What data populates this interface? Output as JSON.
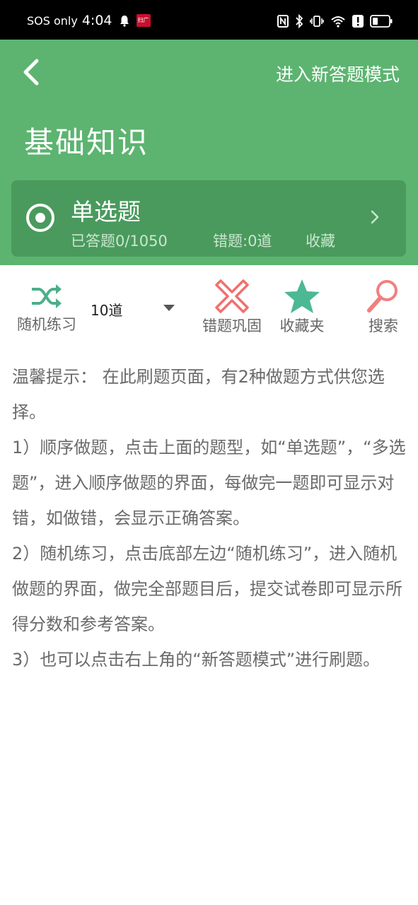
{
  "status_bar": {
    "carrier": "SOS only",
    "time": "4:04",
    "app_badge": "扫广"
  },
  "header": {
    "back_icon": "chevron-left-icon",
    "mode_link": "进入新答题模式",
    "title": "基础知识",
    "bg_color": "#5cb470"
  },
  "question_type_card": {
    "title": "单选题",
    "answered": "已答题0/1050",
    "wrong": "错题:0道",
    "favorite": "收藏",
    "bg_color": "#4a9a5d"
  },
  "toolbar": {
    "random": {
      "label": "随机练习",
      "icon": "shuffle-icon",
      "color": "#4caf8a"
    },
    "count": {
      "value": "10道"
    },
    "mistakes": {
      "label": "错题巩固",
      "icon": "cross-icon",
      "color": "#f07070"
    },
    "favorites": {
      "label": "收藏夹",
      "icon": "star-icon",
      "color": "#4cb894"
    },
    "search": {
      "label": "搜索",
      "icon": "search-icon",
      "color": "#f08080"
    }
  },
  "tips": {
    "line1": "温馨提示：  在此刷题页面，有2种做题方式供您选择。",
    "line2": " 1）顺序做题，点击上面的题型，如“单选题”，“多选题”，进入顺序做题的界面，每做完一题即可显示对错，如做错，会显示正确答案。",
    "line3": " 2）随机练习，点击底部左边“随机练习”，进入随机做题的界面，做完全部题目后，提交试卷即可显示所得分数和参考答案。",
    "line4": " 3）也可以点击右上角的“新答题模式”进行刷题。"
  }
}
